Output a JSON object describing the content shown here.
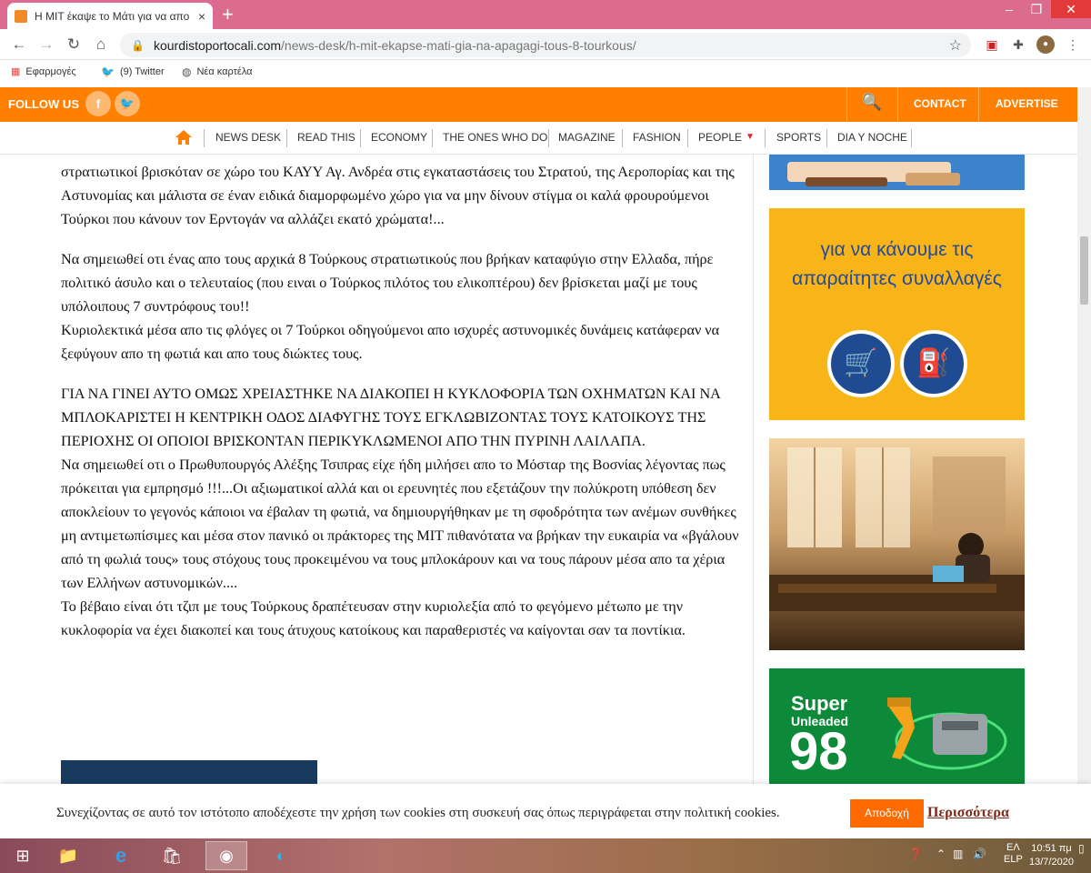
{
  "browser": {
    "tab_title": "Η MIT έκαψε το Μάτι για να απο",
    "tab_close": "×",
    "new_tab": "+",
    "url_host": "kourdistoportocali.com",
    "url_path": "/news-desk/h-mit-ekapse-mati-gia-na-apagagi-tous-8-tourkous/",
    "bookmarks": [
      {
        "label": "Εφαρμογές",
        "icon": "apps-grid-icon"
      },
      {
        "label": "(9) Twitter",
        "icon": "twitter-bird-icon"
      },
      {
        "label": "Νέα καρτέλα",
        "icon": "globe-icon"
      }
    ]
  },
  "header": {
    "follow_us": "FOLLOW US",
    "facebook": "f",
    "contact": "CONTACT",
    "advertise": "ADVERTISE"
  },
  "menu": [
    "NEWS DESK",
    "READ THIS",
    "ECONOMY",
    "THE ONES WHO DO",
    "MAGAZINE",
    "FASHION",
    "PEOPLE",
    "SPORTS",
    "DIA Y NOCHE"
  ],
  "article": {
    "p1": "στρατιωτικοί βρισκόταν σε χώρο του ΚΑΥΥ Αγ. Ανδρέα στις εγκαταστάσεις του Στρατού, της Αεροπορίας και της Αστυνομίας και μάλιστα σε έναν ειδικά διαμορφωμένο χώρο για να μην δίνουν στίγμα οι καλά φρουρούμενοι Τούρκοι που κάνουν τον Ερντογάν να αλλάζει εκατό χρώματα!...",
    "p2a": "Να σημειωθεί οτι ένας απο τους αρχικά 8 Τούρκους στρατιωτικούς που βρήκαν καταφύγιο στην Ελλαδα, πήρε πολιτικό άσυλο και ο τελευταίος (που ειναι ο Τούρκος πιλότος του ελικοπτέρου) δεν βρίσκεται μαζί με τους υπόλοιπους 7 συντρόφους του!!",
    "p2b": "Κυριολεκτικά μέσα απο τις φλόγες οι 7 Τούρκοι οδηγούμενοι απο ισχυρές αστυνομικές δυνάμεις κατάφεραν να ξεφύγουν απο τη φωτιά και απο τους διώκτες τους.",
    "p3a": "ΓΙΑ ΝΑ ΓΙΝΕΙ ΑΥΤΟ ΟΜΩΣ ΧΡΕΙΑΣΤΗΚΕ ΝΑ ΔΙΑΚΟΠΕΙ Η ΚΥΚΛΟΦΟΡΙΑ ΤΩΝ ΟΧΗΜΑΤΩΝ ΚΑΙ ΝΑ ΜΠΛΟΚΑΡΙΣΤΕΙ Η ΚΕΝΤΡΙΚΗ ΟΔΟΣ ΔΙΑΦΥΓΗΣ ΤΟΥΣ ΕΓΚΛΩΒΙΖΟΝΤΑΣ ΤΟΥΣ ΚΑΤΟΙΚΟΥΣ ΤΗΣ ΠΕΡΙΟΧΗΣ ΟΙ ΟΠΟΙΟΙ ΒΡΙΣΚΟΝΤΑΝ ΠΕΡΙΚΥΚΛΩΜΕΝΟΙ ΑΠΟ ΤΗΝ ΠΥΡΙΝΗ ΛΑΙΛΑΠΑ.",
    "p3b": "Να σημειωθεί οτι ο Πρωθυπουργός Αλέξης Τσιπρας είχε ήδη μιλήσει απο το Μόσταρ της Βοσνίας λέγοντας πως πρόκειται για εμπρησμό !!!...Οι αξιωματικοί αλλά και οι ερευνητές που εξετάζουν την πολύκροτη υπόθεση δεν αποκλείουν το γεγονός κάποιοι να έβαλαν τη φωτιά, να δημιουργήθηκαν με τη σφοδρότητα των ανέμων συνθήκες μη αντιμετωπίσιμες και μέσα στον πανικό οι πράκτορες της MIT πιθανότατα να βρήκαν την ευκαιρία να «βγάλουν από τη φωλιά τους» τους στόχους τους προκειμένου να τους μπλοκάρουν και να τους πάρουν μέσα απο τα χέρια των Ελλήνων αστυνομικών....",
    "p3c": "Το βέβαιο είναι ότι τζιπ με τους Τούρκους δραπέτευσαν στην κυριολεξία από το φεγόμενο μέτωπο με την κυκλοφορία να έχει διακοπεί και τους άτυχους κατοίκους και παραθεριστές να καίγονται σαν τα ποντίκια."
  },
  "ads": {
    "ad2_text": "για να κάνουμε τις απαραίτητες συναλλαγές",
    "ad4_super": "Super",
    "ad4_unleaded": "Unleaded",
    "ad4_number": "98"
  },
  "cookie": {
    "message": "Συνεχίζοντας σε αυτό τον ιστότοπο αποδέχεστε την χρήση των cookies στη συσκευή σας όπως περιγράφεται στην πολιτική cookies.",
    "accept": "Αποδοχή",
    "more": "Περισσότερα"
  },
  "taskbar": {
    "lang": "ΕΛ",
    "layout": "ELP",
    "time": "10:51 πμ",
    "date": "13/7/2020"
  },
  "colors": {
    "accent_orange": "#ff7f00",
    "tab_strip": "#dc6c8f",
    "ad_yellow": "#f9b417",
    "ad_green": "#0d8a39"
  }
}
